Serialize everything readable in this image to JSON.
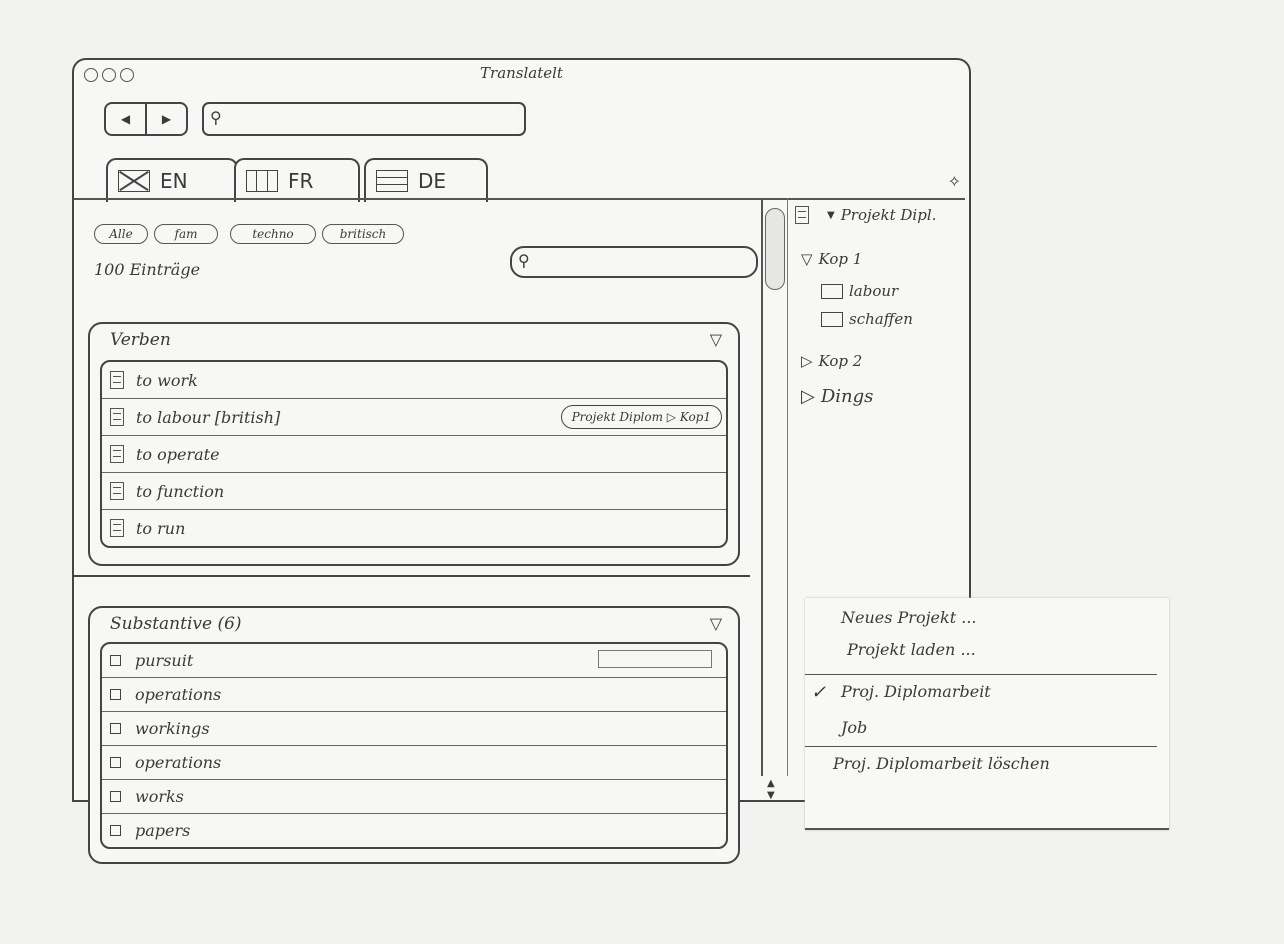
{
  "window": {
    "title": "Translatelt"
  },
  "search": {
    "placeholder": ""
  },
  "tabs": [
    {
      "label": "EN",
      "icon": "flag-en-icon"
    },
    {
      "label": "FR",
      "icon": "flag-fr-icon"
    },
    {
      "label": "DE",
      "icon": "flag-de-icon"
    }
  ],
  "filters": [
    "Alle",
    "fam",
    "techno",
    "britisch"
  ],
  "entries": {
    "count_label": "100 Einträge"
  },
  "verbs": {
    "title": "Verben",
    "rows": [
      "to work",
      "to labour [british]",
      "to operate",
      "to function",
      "to run"
    ],
    "tag": "Projekt Diplom ▷ Kop1"
  },
  "nouns": {
    "title": "Substantive (6)",
    "rows": [
      "pursuit",
      "operations",
      "workings",
      "operations",
      "works",
      "papers"
    ]
  },
  "sidebar": {
    "project": "Projekt Dipl.",
    "tree": [
      {
        "label": "Kop 1",
        "expanded": true,
        "children": [
          "labour",
          "schaffen"
        ]
      },
      {
        "label": "Kop 2",
        "expanded": false
      },
      {
        "label": "Dings",
        "expanded": false
      }
    ]
  },
  "menu": {
    "items": [
      "Neues Projekt ...",
      "Projekt laden ...",
      "Proj. Diplomarbeit",
      "Job",
      "Proj. Diplomarbeit löschen"
    ],
    "checked": "Proj. Diplomarbeit"
  }
}
